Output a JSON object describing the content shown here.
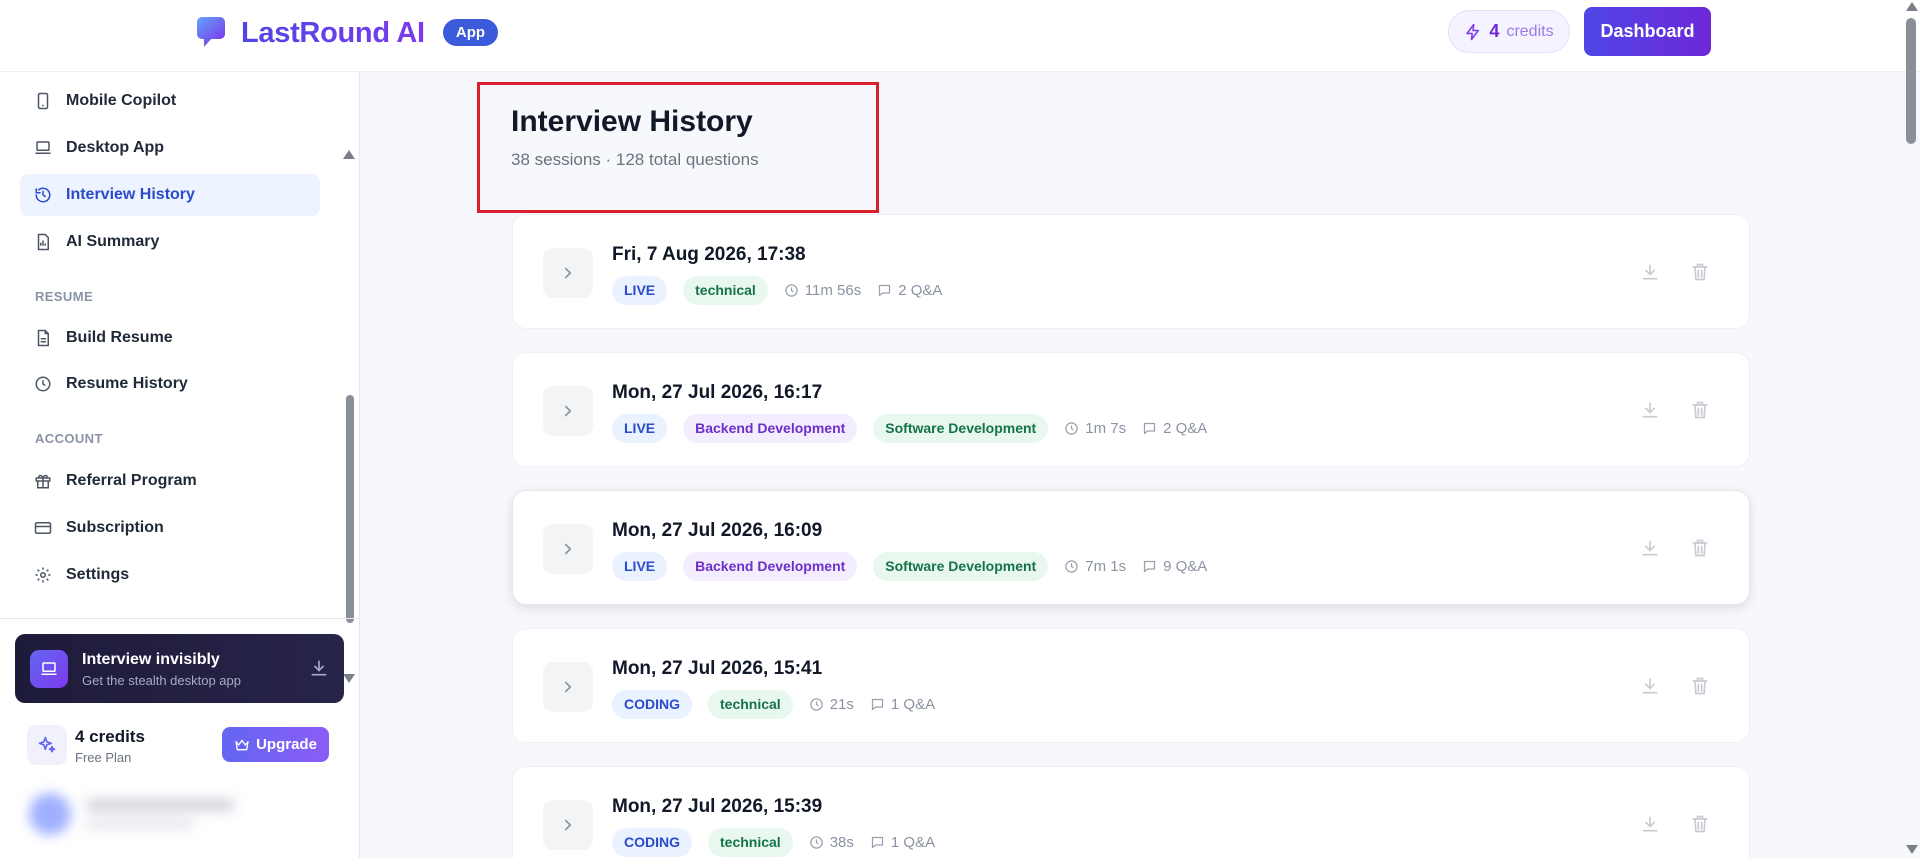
{
  "header": {
    "brand": "LastRound AI",
    "badge": "App",
    "credits_count": "4",
    "credits_label": "credits",
    "dashboard_label": "Dashboard"
  },
  "sidebar": {
    "items": [
      {
        "label": "Mobile Copilot",
        "icon": "mobile-icon"
      },
      {
        "label": "Desktop App",
        "icon": "laptop-icon"
      },
      {
        "label": "Interview History",
        "icon": "history-icon",
        "active": true
      },
      {
        "label": "AI Summary",
        "icon": "document-chart-icon"
      }
    ],
    "resume_section": "RESUME",
    "resume_items": [
      {
        "label": "Build Resume",
        "icon": "file-text-icon"
      },
      {
        "label": "Resume History",
        "icon": "clock-icon"
      }
    ],
    "account_section": "ACCOUNT",
    "account_items": [
      {
        "label": "Referral Program",
        "icon": "gift-icon"
      },
      {
        "label": "Subscription",
        "icon": "credit-card-icon"
      },
      {
        "label": "Settings",
        "icon": "gear-icon"
      }
    ],
    "promo": {
      "title": "Interview invisibly",
      "subtitle": "Get the stealth desktop app"
    },
    "credits": {
      "count": "4 credits",
      "plan": "Free Plan",
      "upgrade_label": "Upgrade"
    }
  },
  "main": {
    "title": "Interview History",
    "subtitle": "38 sessions · 128 total questions",
    "sessions": [
      {
        "date": "Fri, 7 Aug 2026, 17:38",
        "chips": [
          {
            "text": "LIVE",
            "tone": "blue"
          },
          {
            "text": "technical",
            "tone": "green"
          }
        ],
        "duration": "11m 56s",
        "qa": "2 Q&A"
      },
      {
        "date": "Mon, 27 Jul 2026, 16:17",
        "chips": [
          {
            "text": "LIVE",
            "tone": "blue"
          },
          {
            "text": "Backend Development",
            "tone": "purple"
          },
          {
            "text": "Software Development",
            "tone": "green"
          }
        ],
        "duration": "1m 7s",
        "qa": "2 Q&A"
      },
      {
        "date": "Mon, 27 Jul 2026, 16:09",
        "chips": [
          {
            "text": "LIVE",
            "tone": "blue"
          },
          {
            "text": "Backend Development",
            "tone": "purple"
          },
          {
            "text": "Software Development",
            "tone": "green"
          }
        ],
        "duration": "7m 1s",
        "qa": "9 Q&A"
      },
      {
        "date": "Mon, 27 Jul 2026, 15:41",
        "chips": [
          {
            "text": "CODING",
            "tone": "blue"
          },
          {
            "text": "technical",
            "tone": "green"
          }
        ],
        "duration": "21s",
        "qa": "1 Q&A"
      },
      {
        "date": "Mon, 27 Jul 2026, 15:39",
        "chips": [
          {
            "text": "CODING",
            "tone": "blue"
          },
          {
            "text": "technical",
            "tone": "green"
          }
        ],
        "duration": "38s",
        "qa": "1 Q&A"
      }
    ]
  },
  "colors": {
    "accent": "#4f46e5",
    "accent_purple": "#7c3aed",
    "highlight_border": "#dc1f2e"
  }
}
